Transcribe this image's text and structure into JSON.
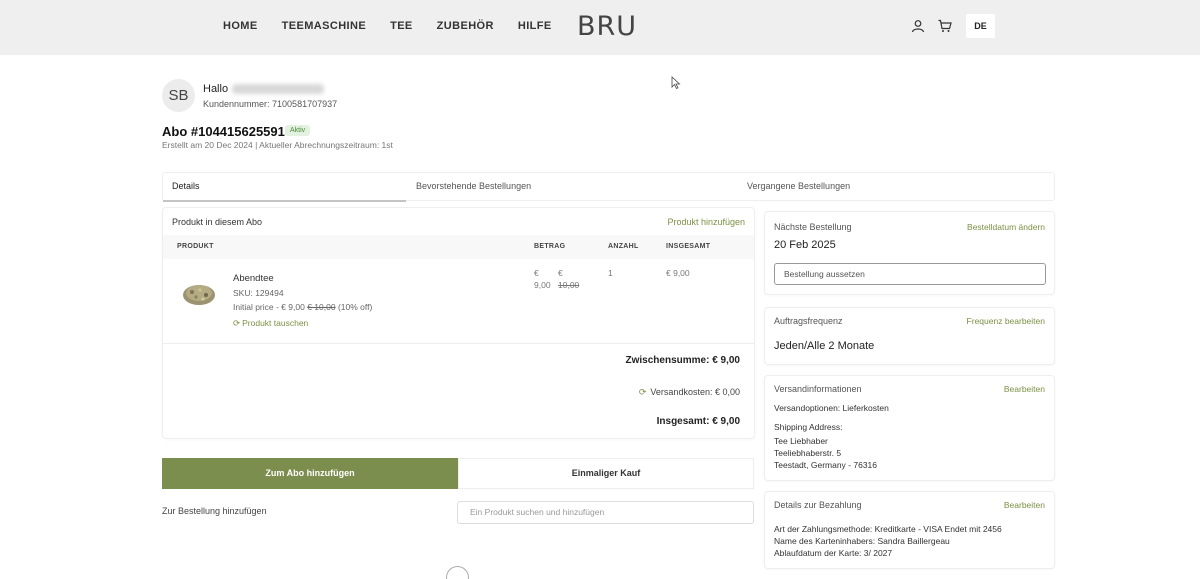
{
  "header": {
    "nav": [
      "HOME",
      "TEEMASCHINE",
      "TEE",
      "ZUBEHÖR",
      "HILFE"
    ],
    "logo": "BRU",
    "language": "DE"
  },
  "profile": {
    "initials": "SB",
    "greeting": "Hallo",
    "customer_number": "Kundennummer: 7100581707937"
  },
  "subscription": {
    "title": "Abo #104415625591",
    "status": "Aktiv",
    "created": "Erstellt am 20 Dec 2024 | Aktueller Abrechnungszeitraum: 1st"
  },
  "tabs": [
    "Details",
    "Bevorstehende Bestellungen",
    "Vergangene Bestellungen"
  ],
  "products": {
    "heading": "Produkt in diesem Abo",
    "add_link": "Produkt hinzufügen",
    "columns": [
      "PRODUKT",
      "BETRAG",
      "ANZAHL",
      "INSGESAMT"
    ],
    "item": {
      "name": "Abendtee",
      "sku": "SKU: 129494",
      "initial_prefix": "Initial price - € 9,00",
      "initial_old": "€ 10,00",
      "initial_suffix": "(10% off)",
      "swap": "Produkt tauschen",
      "price_line1_a": "€",
      "price_line1_b": "€",
      "price_line2_a": "9,00",
      "price_line2_b": "10,00",
      "quantity": "1",
      "total": "€ 9,00"
    },
    "subtotal": "Zwischensumme: € 9,00",
    "shipping": "Versandkosten: € 0,00",
    "grand_total": "Insgesamt: € 9,00"
  },
  "actions": {
    "add_to_sub": "Zum Abo hinzufügen",
    "one_time": "Einmaliger Kauf",
    "add_to_order": "Zur Bestellung hinzufügen",
    "search_placeholder": "Ein Produkt suchen und hinzufügen"
  },
  "next_order": {
    "title": "Nächste Bestellung",
    "link": "Bestelldatum ändern",
    "date": "20 Feb 2025",
    "pause": "Bestellung aussetzen"
  },
  "frequency": {
    "title": "Auftragsfrequenz",
    "link": "Frequenz bearbeiten",
    "value": "Jeden/Alle 2 Monate"
  },
  "shipping_info": {
    "title": "Versandinformationen",
    "link": "Bearbeiten",
    "options": "Versandoptionen: Lieferkosten",
    "address_label": "Shipping Address:",
    "line1": "Tee Liebhaber",
    "line2": "Teeliebhaberstr. 5",
    "line3": "Teestadt, Germany - 76316"
  },
  "payment": {
    "title": "Details zur Bezahlung",
    "link": "Bearbeiten",
    "method": "Art der Zahlungsmethode: Kreditkarte - VISA Endet mit 2456",
    "holder": "Name des Karteninhabers: Sandra Baillergeau",
    "expiry": "Ablaufdatum der Karte: 3/ 2027"
  }
}
